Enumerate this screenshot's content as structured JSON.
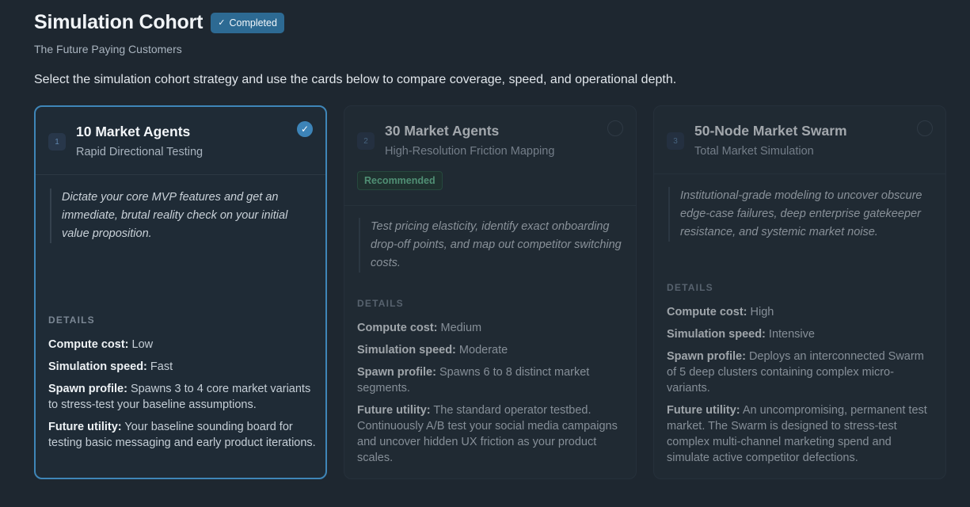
{
  "header": {
    "title": "Simulation Cohort",
    "status_badge": "Completed",
    "subtitle": "The Future Paying Customers"
  },
  "instruction": "Select the simulation cohort strategy and use the cards below to compare coverage, speed, and operational depth.",
  "cards": [
    {
      "number": "1",
      "title": "10 Market Agents",
      "subtitle": "Rapid Directional Testing",
      "selected": true,
      "description": "Dictate your core MVP features and get an immediate, brutal reality check on your initial value proposition.",
      "details_label": "DETAILS",
      "compute_label": "Compute cost:",
      "compute_value": "Low",
      "speed_label": "Simulation speed:",
      "speed_value": "Fast",
      "spawn_label": "Spawn profile:",
      "spawn_value": "Spawns 3 to 4 core market variants to stress-test your baseline assumptions.",
      "utility_label": "Future utility:",
      "utility_value": "Your baseline sounding board for testing basic messaging and early product iterations."
    },
    {
      "number": "2",
      "title": "30 Market Agents",
      "subtitle": "High-Resolution Friction Mapping",
      "badge": "Recommended",
      "selected": false,
      "description": "Test pricing elasticity, identify exact onboarding drop-off points, and map out competitor switching costs.",
      "details_label": "DETAILS",
      "compute_label": "Compute cost:",
      "compute_value": "Medium",
      "speed_label": "Simulation speed:",
      "speed_value": "Moderate",
      "spawn_label": "Spawn profile:",
      "spawn_value": "Spawns 6 to 8 distinct market segments.",
      "utility_label": "Future utility:",
      "utility_value": "The standard operator testbed. Continuously A/B test your social media campaigns and uncover hidden UX friction as your product scales."
    },
    {
      "number": "3",
      "title": "50-Node Market Swarm",
      "subtitle": "Total Market Simulation",
      "selected": false,
      "description": "Institutional-grade modeling to uncover obscure edge-case failures, deep enterprise gatekeeper resistance, and systemic market noise.",
      "details_label": "DETAILS",
      "compute_label": "Compute cost:",
      "compute_value": "High",
      "speed_label": "Simulation speed:",
      "speed_value": "Intensive",
      "spawn_label": "Spawn profile:",
      "spawn_value": "Deploys an interconnected Swarm of 5 deep clusters containing complex micro-variants.",
      "utility_label": "Future utility:",
      "utility_value": "An uncompromising, permanent test market. The Swarm is designed to stress-test complex multi-channel marketing spend and simulate active competitor defections."
    }
  ],
  "icons": {
    "check": "check-icon",
    "selected_radio": "radio-checked-icon",
    "radio": "radio-empty-icon"
  },
  "colors": {
    "accent": "#3d84b8",
    "recommended": "#6fcf9f",
    "background": "#1e2730"
  }
}
